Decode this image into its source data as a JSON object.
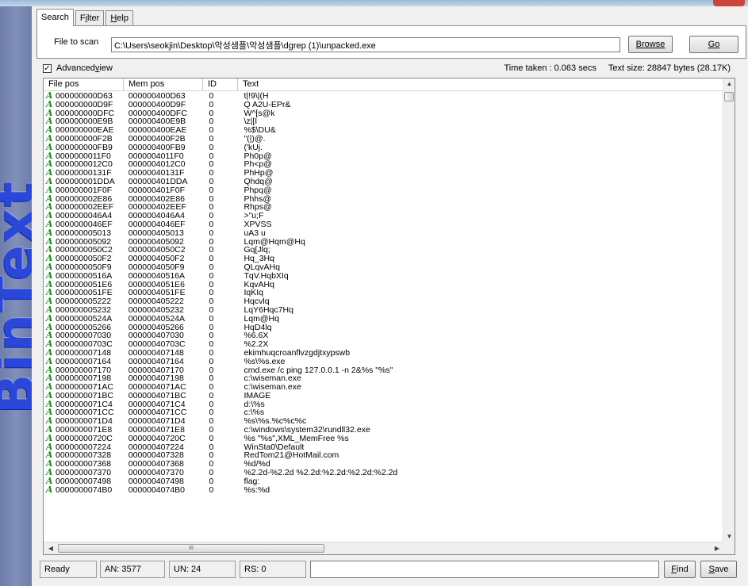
{
  "window": {
    "banner_text": "BinText"
  },
  "tabs": [
    {
      "label": "Search",
      "active": true
    },
    {
      "label": "Filter",
      "underline": "i",
      "pre": "F",
      "post": "lter"
    },
    {
      "label": "Help",
      "underline": "H",
      "pre": "",
      "post": "elp"
    }
  ],
  "search": {
    "file_label": "File to scan",
    "file_value": "C:\\Users\\seokjin\\Desktop\\악성샘플\\악성샘플\\dgrep (1)\\unpacked.exe",
    "browse_label": "Browse",
    "go_label": "Go"
  },
  "options": {
    "advanced_view_checked": true,
    "advanced_view_pre": "Advanced ",
    "advanced_view_u": "v",
    "advanced_view_post": "iew",
    "time_taken": "Time taken : 0.063 secs",
    "text_size": "Text size: 28847 bytes (28.17K)"
  },
  "table": {
    "columns": [
      "File pos",
      "Mem pos",
      "ID",
      "Text"
    ],
    "rows": [
      [
        "000000000D63",
        "000000400D63",
        "0",
        "t|!9\\|(H"
      ],
      [
        "000000000D9F",
        "000000400D9F",
        "0",
        "Q A2U-EPr&"
      ],
      [
        "000000000DFC",
        "000000400DFC",
        "0",
        "W^[s@k"
      ],
      [
        "000000000E9B",
        "000000400E9B",
        "0",
        "\\z|[I"
      ],
      [
        "000000000EAE",
        "000000400EAE",
        "0",
        "%$\\DU&"
      ],
      [
        "000000000F2B",
        "000000400F2B",
        "0",
        "\"(|)@."
      ],
      [
        "000000000FB9",
        "000000400FB9",
        "0",
        "('kUj."
      ],
      [
        "0000000011F0",
        "0000004011F0",
        "0",
        "Ph0p@"
      ],
      [
        "0000000012C0",
        "0000004012C0",
        "0",
        "Ph<p@"
      ],
      [
        "00000000131F",
        "00000040131F",
        "0",
        "PhHp@"
      ],
      [
        "000000001DDA",
        "000000401DDA",
        "0",
        "Qhdq@"
      ],
      [
        "000000001F0F",
        "000000401F0F",
        "0",
        "Phpq@"
      ],
      [
        "000000002E86",
        "000000402E86",
        "0",
        "Phhs@"
      ],
      [
        "000000002EEF",
        "000000402EEF",
        "0",
        "Rhps@"
      ],
      [
        "0000000046A4",
        "0000004046A4",
        "0",
        ">\"u;F"
      ],
      [
        "0000000046EF",
        "0000004046EF",
        "0",
        "XPVSS"
      ],
      [
        "000000005013",
        "000000405013",
        "0",
        "uA3 u"
      ],
      [
        "000000005092",
        "000000405092",
        "0",
        "Lqm@Hqm@Hq"
      ],
      [
        "0000000050C2",
        "0000004050C2",
        "0",
        "Gq[Jlq;"
      ],
      [
        "0000000050F2",
        "0000004050F2",
        "0",
        "Hq_3Hq"
      ],
      [
        "0000000050F9",
        "0000004050F9",
        "0",
        "QLqvAHq"
      ],
      [
        "00000000516A",
        "00000040516A",
        "0",
        "TqV.HqbXIq"
      ],
      [
        "0000000051E6",
        "0000004051E6",
        "0",
        "KqvAHq"
      ],
      [
        "0000000051FE",
        "0000004051FE",
        "0",
        "IqKIq"
      ],
      [
        "000000005222",
        "000000405222",
        "0",
        "Hqcvlq"
      ],
      [
        "000000005232",
        "000000405232",
        "0",
        "LqY6Hqc7Hq"
      ],
      [
        "00000000524A",
        "00000040524A",
        "0",
        "Lqm@Hq"
      ],
      [
        "000000005266",
        "000000405266",
        "0",
        "HqD4lq"
      ],
      [
        "000000007030",
        "000000407030",
        "0",
        "%6.6X"
      ],
      [
        "00000000703C",
        "00000040703C",
        "0",
        "%2.2X"
      ],
      [
        "000000007148",
        "000000407148",
        "0",
        "ekimhuqcroanflvzgdjtxypswb"
      ],
      [
        "000000007164",
        "000000407164",
        "0",
        "%s\\%s.exe"
      ],
      [
        "000000007170",
        "000000407170",
        "0",
        "cmd.exe /c ping 127.0.0.1 -n 2&%s \"%s\""
      ],
      [
        "000000007198",
        "000000407198",
        "0",
        "c:\\wiseman.exe"
      ],
      [
        "0000000071AC",
        "0000004071AC",
        "0",
        "c:\\wiseman.exe"
      ],
      [
        "0000000071BC",
        "0000004071BC",
        "0",
        "IMAGE"
      ],
      [
        "0000000071C4",
        "0000004071C4",
        "0",
        "d:\\%s"
      ],
      [
        "0000000071CC",
        "0000004071CC",
        "0",
        "c:\\%s"
      ],
      [
        "0000000071D4",
        "0000004071D4",
        "0",
        "%s\\%s.%c%c%c"
      ],
      [
        "0000000071E8",
        "0000004071E8",
        "0",
        "c:\\windows\\system32\\rundll32.exe"
      ],
      [
        "00000000720C",
        "00000040720C",
        "0",
        "%s \"%s\",XML_MemFree %s"
      ],
      [
        "000000007224",
        "000000407224",
        "0",
        "WinSta0\\Default"
      ],
      [
        "000000007328",
        "000000407328",
        "0",
        "RedTom21@HotMail.com"
      ],
      [
        "000000007368",
        "000000407368",
        "0",
        "%d/%d"
      ],
      [
        "000000007370",
        "000000407370",
        "0",
        "%2.2d-%2.2d %2.2d:%2.2d:%2.2d:%2.2d"
      ],
      [
        "000000007498",
        "000000407498",
        "0",
        "flag:"
      ],
      [
        "0000000074B0",
        "0000004074B0",
        "0",
        "%s:%d"
      ]
    ],
    "row_icon": "A"
  },
  "scrollbar": {
    "thumb_grip": "III"
  },
  "status": {
    "ready": "Ready",
    "an": "AN: 3577",
    "un": "UN: 24",
    "rs": "RS: 0",
    "find_value": "",
    "find_pre": "",
    "find_u": "F",
    "find_post": "ind",
    "save_pre": "",
    "save_u": "S",
    "save_post": "ave"
  },
  "colors": {
    "accent_icon": "#1e8a1e",
    "banner_text": "#2a47d8",
    "banner_bg": "#7585b0"
  }
}
